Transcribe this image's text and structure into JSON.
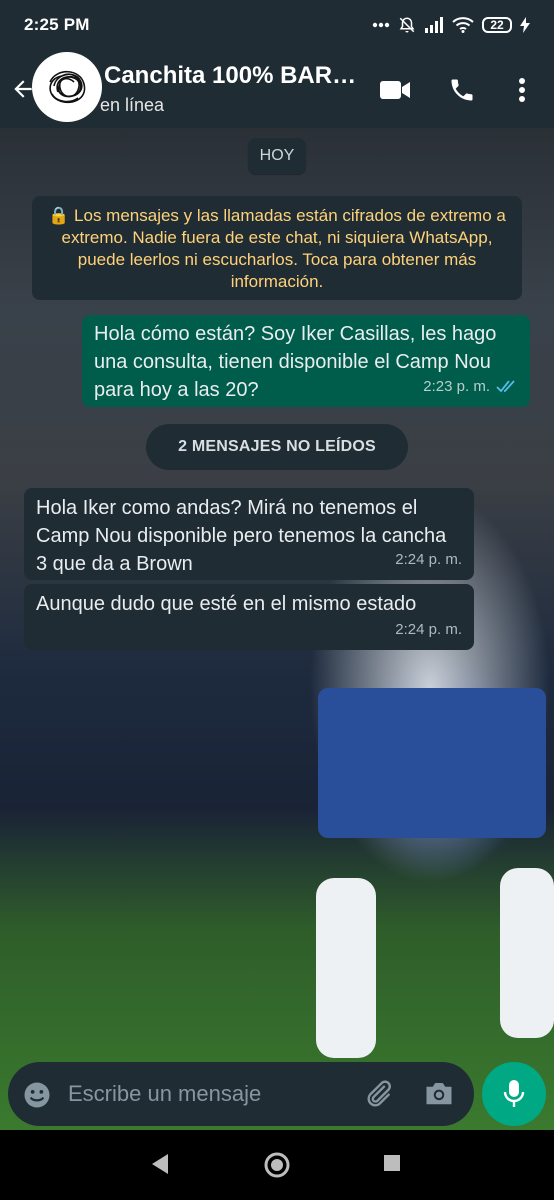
{
  "status_bar": {
    "time": "2:25 PM",
    "battery": "22"
  },
  "header": {
    "title": "Canchita 100% BARR...",
    "subtitle": "en línea",
    "icons": [
      "back-arrow-icon",
      "video-call-icon",
      "phone-icon",
      "more-vert-icon"
    ]
  },
  "chat": {
    "date_label": "HOY",
    "encryption_notice": "🔒 Los mensajes y las llamadas están cifrados de extremo a extremo. Nadie fuera de este chat, ni siquiera WhatsApp, puede leerlos ni escucharlos. Toca para obtener más información.",
    "unread_label": "2 MENSAJES NO LEÍDOS",
    "messages": [
      {
        "direction": "out",
        "text": "Hola cómo están? Soy Iker Casillas, les hago una consulta, tienen disponible el Camp Nou para hoy a las 20?",
        "time": "2:23 p. m.",
        "status": "read"
      },
      {
        "direction": "in",
        "text": "Hola Iker como andas? Mirá no tenemos el Camp Nou disponible pero tenemos la cancha 3 que da a Brown",
        "time": "2:24 p. m."
      },
      {
        "direction": "in",
        "text": "Aunque dudo que esté en el mismo estado",
        "time": "2:24 p. m."
      }
    ]
  },
  "composer": {
    "placeholder": "Escribe un mensaje"
  },
  "colors": {
    "bar": "#1f2c34",
    "outgoing_bubble": "#005c4b",
    "incoming_bubble": "#1f2c34",
    "accent": "#00a884",
    "notice_text": "#ffd279",
    "read_ticks": "#53bdeb"
  }
}
